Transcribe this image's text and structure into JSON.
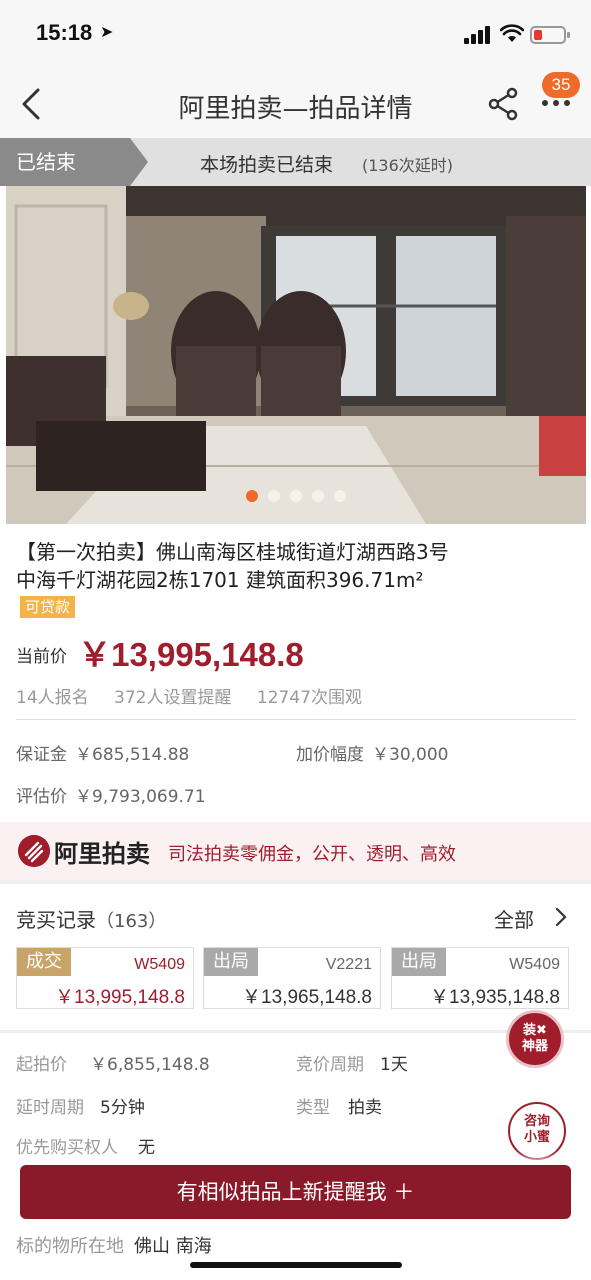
{
  "status_bar": {
    "time": "15:18"
  },
  "nav": {
    "title": "阿里拍卖—拍品详情",
    "badge_count": "35"
  },
  "auction_status": {
    "state": "已结束",
    "message": "本场拍卖已结束",
    "extension": "(136次延时)"
  },
  "gallery": {
    "image_description_icon": "living-room-photo",
    "page_count": 5,
    "current_page": 1
  },
  "item": {
    "title": "【第一次拍卖】佛山南海区桂城街道灯湖西路3号中海千灯湖花园2栋1701 建筑面积396.71m²",
    "loan_badge": "可贷款",
    "current_price_label": "当前价",
    "current_price": "￥13,995,148.8",
    "signups": "14人报名",
    "reminders": "372人设置提醒",
    "views": "12747次围观"
  },
  "fees": {
    "deposit_label": "保证金",
    "deposit_value": "￥685,514.88",
    "increment_label": "加价幅度",
    "increment_value": "￥30,000",
    "appraisal_label": "评估价",
    "appraisal_value": "￥9,793,069.71"
  },
  "brand": {
    "name": "阿里拍卖",
    "slogan": "司法拍卖零佣金，公开、透明、高效"
  },
  "records": {
    "title": "竞买记录",
    "count": "（163）",
    "all_label": "全部",
    "bids": [
      {
        "tag": "成交",
        "user": "W5409",
        "price": "￥13,995,148.8"
      },
      {
        "tag": "出局",
        "user": "V2221",
        "price": "￥13,965,148.8"
      },
      {
        "tag": "出局",
        "user": "W5409",
        "price": "￥13,935,148.8"
      }
    ]
  },
  "details": {
    "start_price_label": "起拍价",
    "start_price_value": "￥6,855,148.8",
    "cycle_label": "竞价周期",
    "cycle_value": "1天",
    "delay_label": "延时周期",
    "delay_value": "5分钟",
    "type_label": "类型",
    "type_value": "拍卖",
    "priority_label": "优先购买权人",
    "priority_value": "无",
    "location_label": "标的物所在地",
    "location_value": "佛山 南海"
  },
  "floating": {
    "decor_line1": "装✖",
    "decor_line2": "神器",
    "consult_line1": "咨询",
    "consult_line2": "小蜜"
  },
  "cta": {
    "label": "有相似拍品上新提醒我 ＋"
  },
  "colors": {
    "brand_red": "#a01e2c",
    "accent_orange": "#f06a2a",
    "win_tag": "#c8a46a",
    "out_tag": "#a9a9a9"
  }
}
